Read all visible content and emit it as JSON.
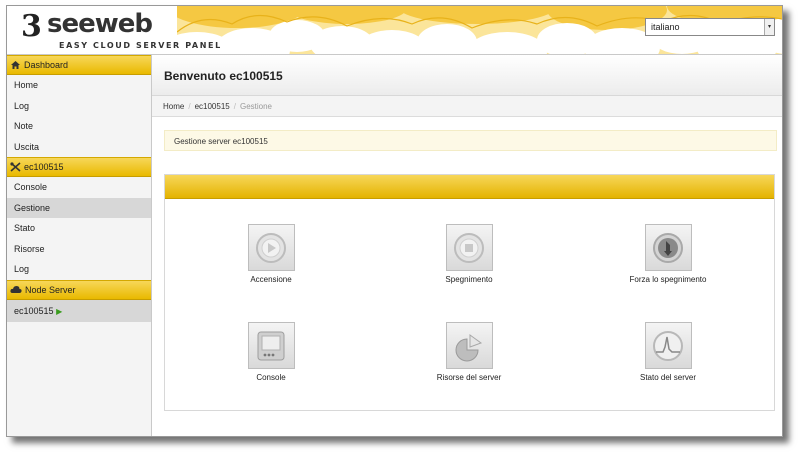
{
  "header": {
    "logo_mark": "3",
    "logo_text": "seeweb",
    "logo_sub": "EASY CLOUD SERVER PANEL",
    "language": "italiano"
  },
  "sidebar": {
    "sections": [
      {
        "label": "Dashboard",
        "icon": "home-icon",
        "items": [
          {
            "label": "Home"
          },
          {
            "label": "Log"
          },
          {
            "label": "Note"
          },
          {
            "label": "Uscita"
          }
        ]
      },
      {
        "label": "ec100515",
        "icon": "tools-icon",
        "items": [
          {
            "label": "Console"
          },
          {
            "label": "Gestione"
          },
          {
            "label": "Stato"
          },
          {
            "label": "Risorse"
          },
          {
            "label": "Log"
          }
        ]
      },
      {
        "label": "Node Server",
        "icon": "cloud-icon",
        "items": [
          {
            "label": "ec100515"
          }
        ]
      }
    ]
  },
  "main": {
    "title": "Benvenuto ec100515",
    "breadcrumb": [
      "Home",
      "ec100515",
      "Gestione"
    ],
    "notice": "Gestione server ec100515",
    "actions": [
      {
        "label": "Accensione",
        "icon": "power-on-icon"
      },
      {
        "label": "Spegnimento",
        "icon": "power-off-icon"
      },
      {
        "label": "Forza lo spegnimento",
        "icon": "force-shutdown-icon"
      },
      {
        "label": "Console",
        "icon": "console-icon"
      },
      {
        "label": "Risorse del server",
        "icon": "pie-chart-icon"
      },
      {
        "label": "Stato del server",
        "icon": "status-chart-icon"
      }
    ]
  },
  "colors": {
    "accent": "#e9b900",
    "active_item": "#d7d7d7",
    "notice_bg": "#fdf9e6"
  }
}
